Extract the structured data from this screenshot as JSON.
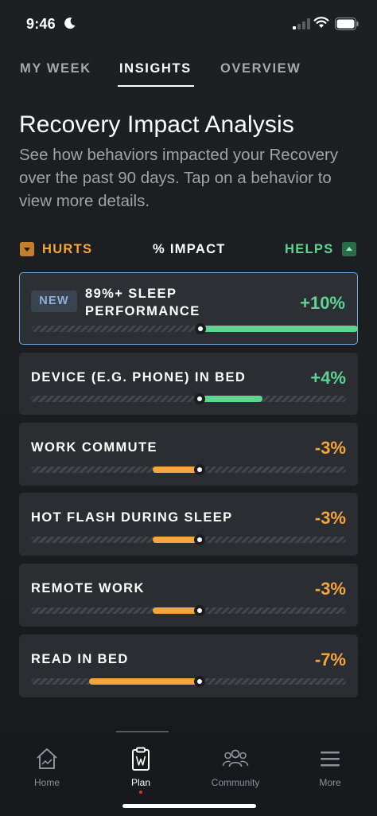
{
  "status_bar": {
    "time": "9:46"
  },
  "tabs": [
    {
      "label": "MY WEEK",
      "active": false
    },
    {
      "label": "INSIGHTS",
      "active": true
    },
    {
      "label": "OVERVIEW",
      "active": false
    }
  ],
  "header": {
    "title": "Recovery Impact Analysis",
    "subtitle": "See how behaviors impacted your Recovery over the past 90 days. Tap on a behavior to view more details."
  },
  "legend": {
    "hurts_label": "HURTS",
    "impact_label": "% IMPACT",
    "helps_label": "HELPS"
  },
  "colors": {
    "helps": "#5fd391",
    "hurts": "#f4a53c",
    "selected_border": "#7aa8d6"
  },
  "behaviors": [
    {
      "badge": "NEW",
      "label_line1": "89%+ SLEEP",
      "label_line2": "PERFORMANCE",
      "value": "+10%",
      "impact": 10,
      "selected": true
    },
    {
      "label": "DEVICE (E.G. PHONE) IN BED",
      "value": "+4%",
      "impact": 4
    },
    {
      "label": "WORK COMMUTE",
      "value": "-3%",
      "impact": -3
    },
    {
      "label": "HOT FLASH DURING SLEEP",
      "value": "-3%",
      "impact": -3
    },
    {
      "label": "REMOTE WORK",
      "value": "-3%",
      "impact": -3
    },
    {
      "label": "READ IN BED",
      "value": "-7%",
      "impact": -7
    }
  ],
  "bottom_nav": [
    {
      "label": "Home",
      "icon": "home-icon",
      "active": false
    },
    {
      "label": "Plan",
      "icon": "plan-clipboard-icon",
      "active": true
    },
    {
      "label": "Community",
      "icon": "community-icon",
      "active": false
    },
    {
      "label": "More",
      "icon": "menu-icon",
      "active": false
    }
  ]
}
